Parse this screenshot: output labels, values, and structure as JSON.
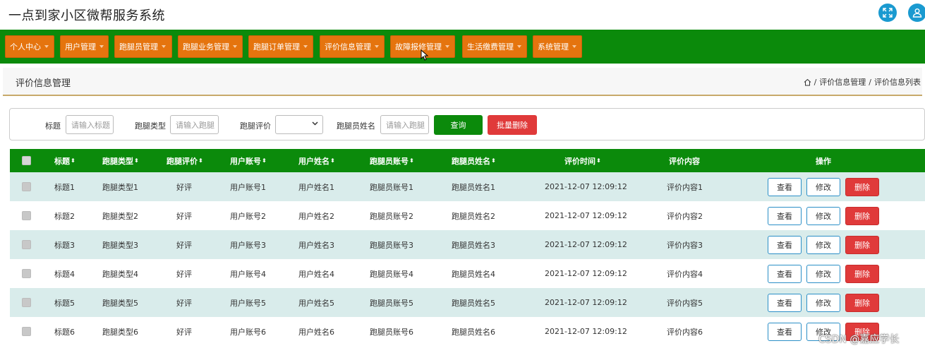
{
  "header": {
    "app_title": "一点到家小区微帮服务系统",
    "fullscreen_icon": "expand-icon",
    "user_icon": "user-icon"
  },
  "nav": {
    "items": [
      {
        "label": "个人中心"
      },
      {
        "label": "用户管理"
      },
      {
        "label": "跑腿员管理"
      },
      {
        "label": "跑腿业务管理"
      },
      {
        "label": "跑腿订单管理"
      },
      {
        "label": "评价信息管理"
      },
      {
        "label": "故障报修管理"
      },
      {
        "label": "生活缴费管理"
      },
      {
        "label": "系统管理"
      }
    ]
  },
  "page": {
    "title": "评价信息管理",
    "breadcrumb": [
      "评价信息管理",
      "评价信息列表"
    ],
    "separator": "/"
  },
  "search": {
    "title_label": "标题",
    "title_placeholder": "请输入标题",
    "type_label": "跑腿类型",
    "type_placeholder": "请输入跑腿",
    "rating_label": "跑腿评价",
    "rating_value": "",
    "runner_label": "跑腿员姓名",
    "runner_placeholder": "请输入跑腿",
    "query_button": "查询",
    "batch_delete_button": "批量删除"
  },
  "table": {
    "columns": [
      "标题",
      "跑腿类型",
      "跑腿评价",
      "用户账号",
      "用户姓名",
      "跑腿员账号",
      "跑腿员姓名",
      "评价时间",
      "评价内容",
      "操作"
    ],
    "rows": [
      {
        "title": "标题1",
        "type": "跑腿类型1",
        "rating": "好评",
        "user_account": "用户账号1",
        "user_name": "用户姓名1",
        "runner_account": "跑腿员账号1",
        "runner_name": "跑腿员姓名1",
        "time": "2021-12-07 12:09:12",
        "content": "评价内容1"
      },
      {
        "title": "标题2",
        "type": "跑腿类型2",
        "rating": "好评",
        "user_account": "用户账号2",
        "user_name": "用户姓名2",
        "runner_account": "跑腿员账号2",
        "runner_name": "跑腿员姓名2",
        "time": "2021-12-07 12:09:12",
        "content": "评价内容2"
      },
      {
        "title": "标题3",
        "type": "跑腿类型3",
        "rating": "好评",
        "user_account": "用户账号3",
        "user_name": "用户姓名3",
        "runner_account": "跑腿员账号3",
        "runner_name": "跑腿员姓名3",
        "time": "2021-12-07 12:09:12",
        "content": "评价内容3"
      },
      {
        "title": "标题4",
        "type": "跑腿类型4",
        "rating": "好评",
        "user_account": "用户账号4",
        "user_name": "用户姓名4",
        "runner_account": "跑腿员账号4",
        "runner_name": "跑腿员姓名4",
        "time": "2021-12-07 12:09:12",
        "content": "评价内容4"
      },
      {
        "title": "标题5",
        "type": "跑腿类型5",
        "rating": "好评",
        "user_account": "用户账号5",
        "user_name": "用户姓名5",
        "runner_account": "跑腿员账号5",
        "runner_name": "跑腿员姓名5",
        "time": "2021-12-07 12:09:12",
        "content": "评价内容5"
      },
      {
        "title": "标题6",
        "type": "跑腿类型6",
        "rating": "好评",
        "user_account": "用户账号6",
        "user_name": "用户姓名6",
        "runner_account": "跑腿员账号6",
        "runner_name": "跑腿员姓名6",
        "time": "2021-12-07 12:09:12",
        "content": "评价内容6"
      }
    ],
    "actions": {
      "view": "查看",
      "edit": "修改",
      "delete": "删除"
    }
  },
  "watermark": "CSDN @嘉应学长",
  "colors": {
    "nav_bg": "#0b8a0b",
    "nav_item": "#e5740e",
    "row_stripe": "#d9eceb",
    "danger": "#e03a3a",
    "accent_blue": "#1a9ad0"
  }
}
